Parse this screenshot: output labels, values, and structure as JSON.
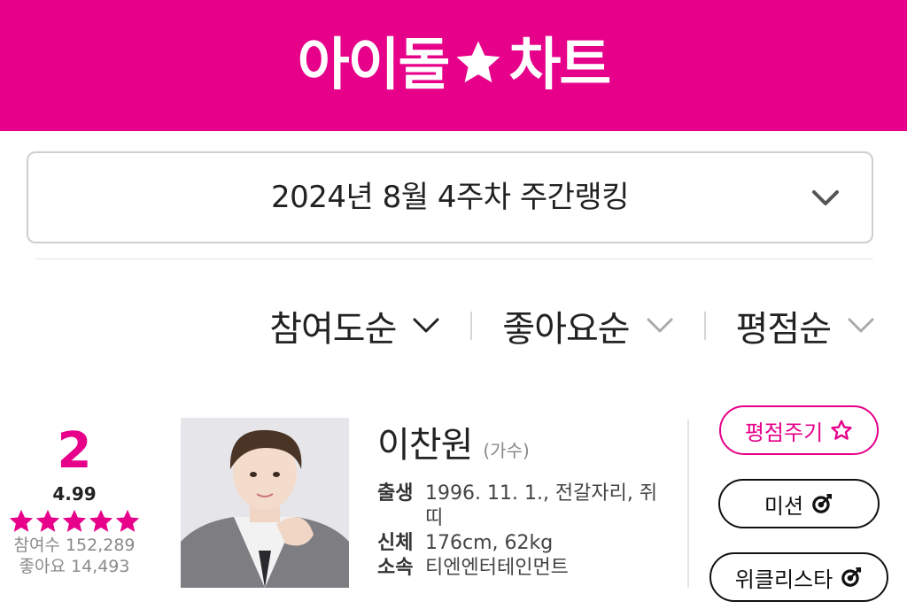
{
  "header": {
    "logo_left": "아이돌",
    "logo_right": "차트",
    "logo_icon": "star-icon",
    "brand_color": "#e6008a"
  },
  "week_select": {
    "label": "2024년 8월 4주차 주간랭킹",
    "icon": "chevron-down-icon"
  },
  "sort": {
    "items": [
      {
        "label": "참여도순"
      },
      {
        "label": "좋아요순"
      },
      {
        "label": "평점순"
      }
    ]
  },
  "entry": {
    "rank": "2",
    "rating": "4.99",
    "stars_filled": 5,
    "participants": "참여수 152,289",
    "likes": "좋아요 14,493",
    "name": "이찬원",
    "role": "(가수)",
    "facts": [
      {
        "key": "출생",
        "value": "1996. 11. 1., 전갈자리, 쥐띠"
      },
      {
        "key": "신체",
        "value": "176cm, 62kg"
      },
      {
        "key": "소속",
        "value": "티엔엔터테인먼트"
      }
    ],
    "buttons": {
      "rate": "평점주기",
      "mission": "미션",
      "weekly": "위클리스타"
    }
  }
}
